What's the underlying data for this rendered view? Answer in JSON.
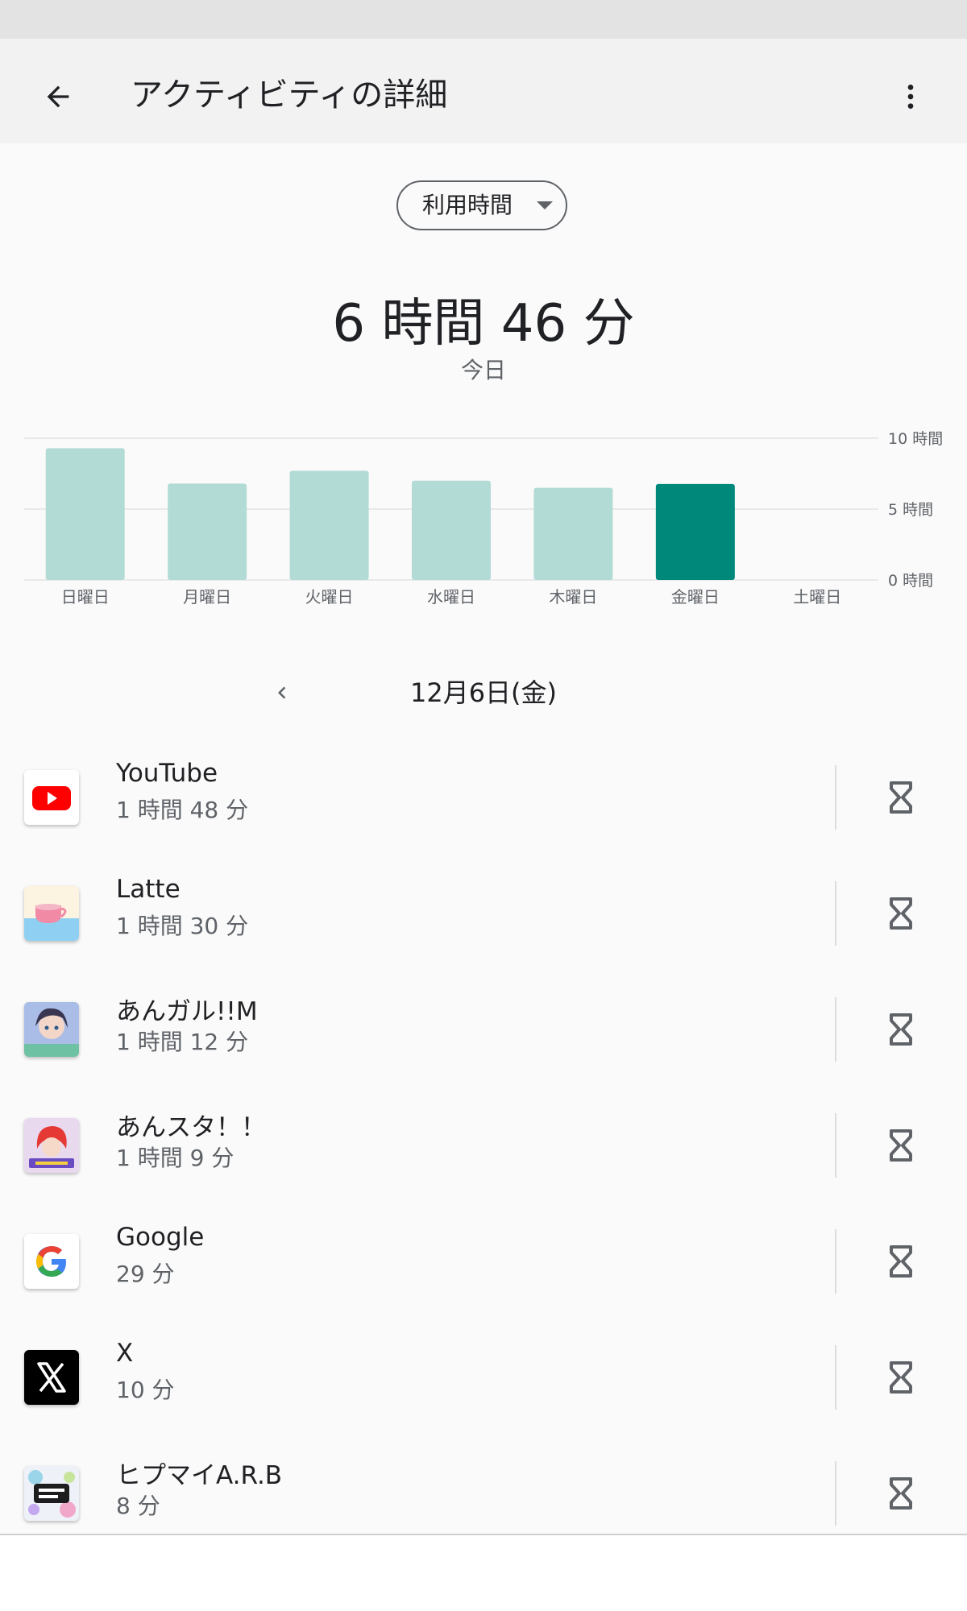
{
  "header": {
    "title": "アクティビティの詳細",
    "back_icon": "arrow-back-icon",
    "more_icon": "more-vert-icon"
  },
  "metric_selector": {
    "selected": "利用時間"
  },
  "summary": {
    "total_time": "6 時間 46 分",
    "period": "今日"
  },
  "chart_data": {
    "type": "bar",
    "categories": [
      "日曜日",
      "月曜日",
      "火曜日",
      "水曜日",
      "木曜日",
      "金曜日",
      "土曜日"
    ],
    "values": [
      9.3,
      6.8,
      7.7,
      7.0,
      6.5,
      6.77,
      0
    ],
    "highlight_index": 5,
    "ylim": [
      0,
      10
    ],
    "yticks": [
      "10 時間",
      "5 時間",
      "0 時間"
    ],
    "ytick_values": [
      10,
      5,
      0
    ],
    "colors": {
      "normal": "#b2dbd6",
      "highlight": "#00897b"
    },
    "grid": true
  },
  "date_nav": {
    "prev_icon": "chevron-left-icon",
    "date": "12月6日(金)"
  },
  "apps": [
    {
      "name": "YouTube",
      "time": "1 時間 48 分",
      "icon": "youtube-icon"
    },
    {
      "name": "Latte",
      "time": "1 時間 30 分",
      "icon": "latte-icon"
    },
    {
      "name": "あんガル!!M",
      "time": "1 時間 12 分",
      "icon": "anngaru-icon"
    },
    {
      "name": "あんスタ！！",
      "time": "1 時間 9 分",
      "icon": "ansuta-icon"
    },
    {
      "name": "Google",
      "time": "29 分",
      "icon": "google-icon"
    },
    {
      "name": "X",
      "time": "10 分",
      "icon": "x-icon"
    },
    {
      "name": "ヒプマイA.R.B",
      "time": "8 分",
      "icon": "hypmic-icon"
    }
  ],
  "timer_icon": "hourglass-icon"
}
